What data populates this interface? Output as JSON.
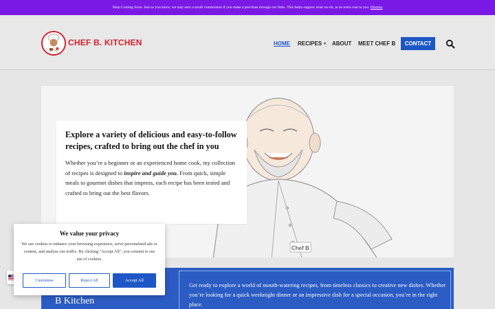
{
  "notice": {
    "text": "Shop Coming Soon. Just so you know, we may earn a small commission if you make a purchase through our links. This helps support what we do, at no extra cost to you.",
    "dismiss": "Dismiss"
  },
  "header": {
    "brand": "CHEF B. KITCHEN",
    "nav": {
      "home": "HOME",
      "recipes": "RECIPES",
      "about": "ABOUT",
      "meet": "MEET CHEF B",
      "contact": "CONTACT"
    },
    "icons": {
      "search": "search-icon",
      "dropdown": "chevron-down-icon"
    },
    "accent_color": "#1d57c6",
    "brand_color": "#d61f2a"
  },
  "hero": {
    "title": "Explore a variety of delicious and easy-to-follow recipes, crafted to bring out the chef in you",
    "body_before": "Whether you’re a beginner or an experienced home cook, my collection of recipes is designed to ",
    "body_emphasis": "inspire and guide you.",
    "body_after": " From quick, simple meals to gourmet dishes that impress, each recipe has been tested and crafted to bring out the best flavors.",
    "illustration_label": "Chef B"
  },
  "intro": {
    "title": "B Kitchen",
    "text": "Get ready to explore a world of mouth-watering recipes, from timeless classics to creative new dishes. Whether you’re looking for a quick weeknight dinner or an impressive dish for a special occasion, you’re in the right place."
  },
  "privacy": {
    "title": "We value your privacy",
    "text": "We use cookies to enhance your browsing experience, serve personalised ads or content, and analyse our traffic. By clicking \"Accept All\", you consent to our use of cookies.",
    "customise": "Customise",
    "reject": "Reject All",
    "accept": "Accept All"
  },
  "language": {
    "icon": "us-flag-icon"
  }
}
